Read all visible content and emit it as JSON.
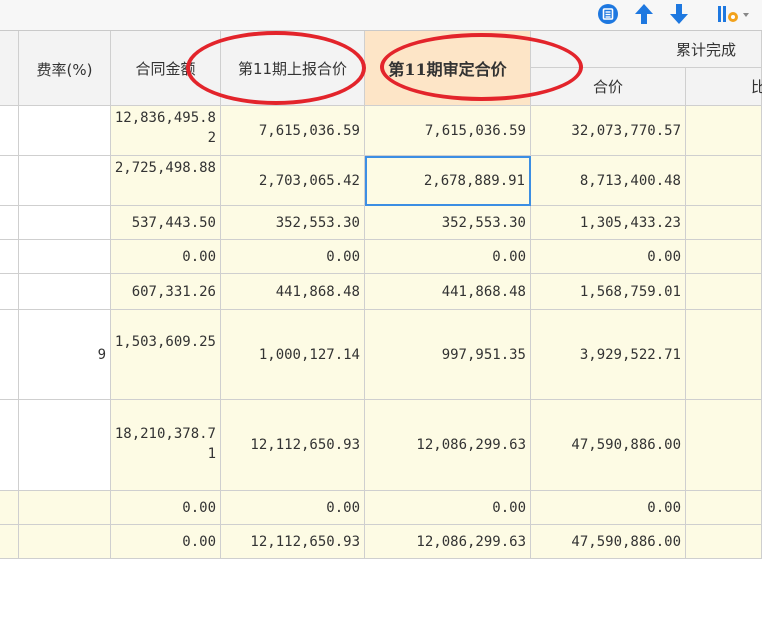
{
  "headers": {
    "rate": "费率(%)",
    "contract_amount": "合同金额",
    "reported_price": "第11期上报合价",
    "approved_price": "第11期审定合价",
    "cumulative_group": "累计完成",
    "cumulative_price": "合价",
    "cumulative_ratio": "比"
  },
  "rows": [
    {
      "rate": "",
      "contract": "12,836,495.82",
      "reported": "7,615,036.59",
      "approved": "7,615,036.59",
      "cumulative": "32,073,770.57"
    },
    {
      "rate": "",
      "contract": "2,725,498.88",
      "reported": "2,703,065.42",
      "approved": "2,678,889.91",
      "cumulative": "8,713,400.48"
    },
    {
      "rate": "",
      "contract": "537,443.50",
      "reported": "352,553.30",
      "approved": "352,553.30",
      "cumulative": "1,305,433.23"
    },
    {
      "rate": "",
      "contract": "0.00",
      "reported": "0.00",
      "approved": "0.00",
      "cumulative": "0.00"
    },
    {
      "rate": "",
      "contract": "607,331.26",
      "reported": "441,868.48",
      "approved": "441,868.48",
      "cumulative": "1,568,759.01"
    },
    {
      "rate": "9",
      "contract": "1,503,609.25",
      "reported": "1,000,127.14",
      "approved": "997,951.35",
      "cumulative": "3,929,522.71"
    },
    {
      "rate": "",
      "contract": "18,210,378.71",
      "reported": "12,112,650.93",
      "approved": "12,086,299.63",
      "cumulative": "47,590,886.00"
    },
    {
      "rate": "",
      "contract": "0.00",
      "reported": "0.00",
      "approved": "0.00",
      "cumulative": "0.00"
    },
    {
      "rate": "",
      "contract": "0.00",
      "reported": "12,112,650.93",
      "approved": "12,086,299.63",
      "cumulative": "47,590,886.00"
    }
  ],
  "colors": {
    "highlight_header": "#fde5c7",
    "row_yellow": "#fdfbe4",
    "annotation_red": "#e3242b",
    "selection_blue": "#3c8ee3"
  },
  "toolbar_icons": [
    "list-icon",
    "arrow-up-icon",
    "arrow-down-icon",
    "settings-icon"
  ]
}
